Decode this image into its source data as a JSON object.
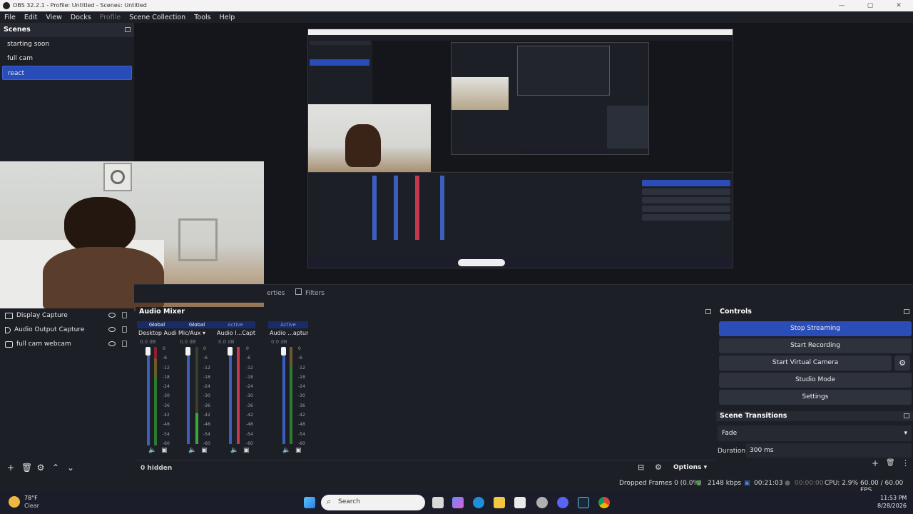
{
  "window": {
    "title": "OBS 32.2.1 - Profile: Untitled - Scenes: Untitled",
    "controls": [
      "—",
      "▢",
      "✕"
    ]
  },
  "menu": [
    "File",
    "Edit",
    "View",
    "Docks",
    "Profile",
    "Scene Collection",
    "Tools",
    "Help"
  ],
  "scenes": {
    "title": "Scenes",
    "items": [
      {
        "label": "starting soon",
        "selected": false
      },
      {
        "label": "full cam",
        "selected": false
      },
      {
        "label": "react",
        "selected": true
      }
    ]
  },
  "tabs": {
    "properties": "erties",
    "filters": "Filters"
  },
  "sources": {
    "items": [
      {
        "label": "Display Capture",
        "icon": "monitor-icon"
      },
      {
        "label": "Audio Output Capture",
        "icon": "speaker-icon"
      },
      {
        "label": "full cam webcam",
        "icon": "camera-icon"
      }
    ]
  },
  "mixer": {
    "title": "Audio Mixer",
    "channels": [
      {
        "status": "Global",
        "name": "Desktop Audio",
        "db": "0.0 dB"
      },
      {
        "status": "Global",
        "name": "Mic/Aux",
        "db": "0.0 dB"
      },
      {
        "status": "Active",
        "name": "Audio I...Capture",
        "db": "0.0 dB"
      },
      {
        "status": "Active",
        "name": "Audio ...apture",
        "db": "0.0 dB"
      }
    ],
    "scale": [
      "0",
      "-6",
      "-12",
      "-18",
      "-24",
      "-30",
      "-36",
      "-42",
      "-48",
      "-54",
      "-60"
    ],
    "hidden": "0 hidden",
    "options": "Options"
  },
  "controls": {
    "title": "Controls",
    "stop_streaming": "Stop Streaming",
    "start_recording": "Start Recording",
    "start_virtual_camera": "Start Virtual Camera",
    "studio_mode": "Studio Mode",
    "settings": "Settings"
  },
  "transitions": {
    "title": "Scene Transitions",
    "selected": "Fade",
    "duration_label": "Duration",
    "duration_value": "300 ms"
  },
  "status": {
    "dropped": "Dropped Frames 0 (0.0%)",
    "bitrate": "2148 kbps",
    "stream_time": "00:21:03",
    "rec_time": "00:00:00",
    "cpu": "CPU: 2.9%",
    "fps": "60.00 / 60.00 FPS"
  },
  "taskbar": {
    "weather_temp": "78°F",
    "weather_desc": "Clear",
    "search_placeholder": "Search",
    "time": "11:53 PM",
    "date": "8/28/2026"
  }
}
